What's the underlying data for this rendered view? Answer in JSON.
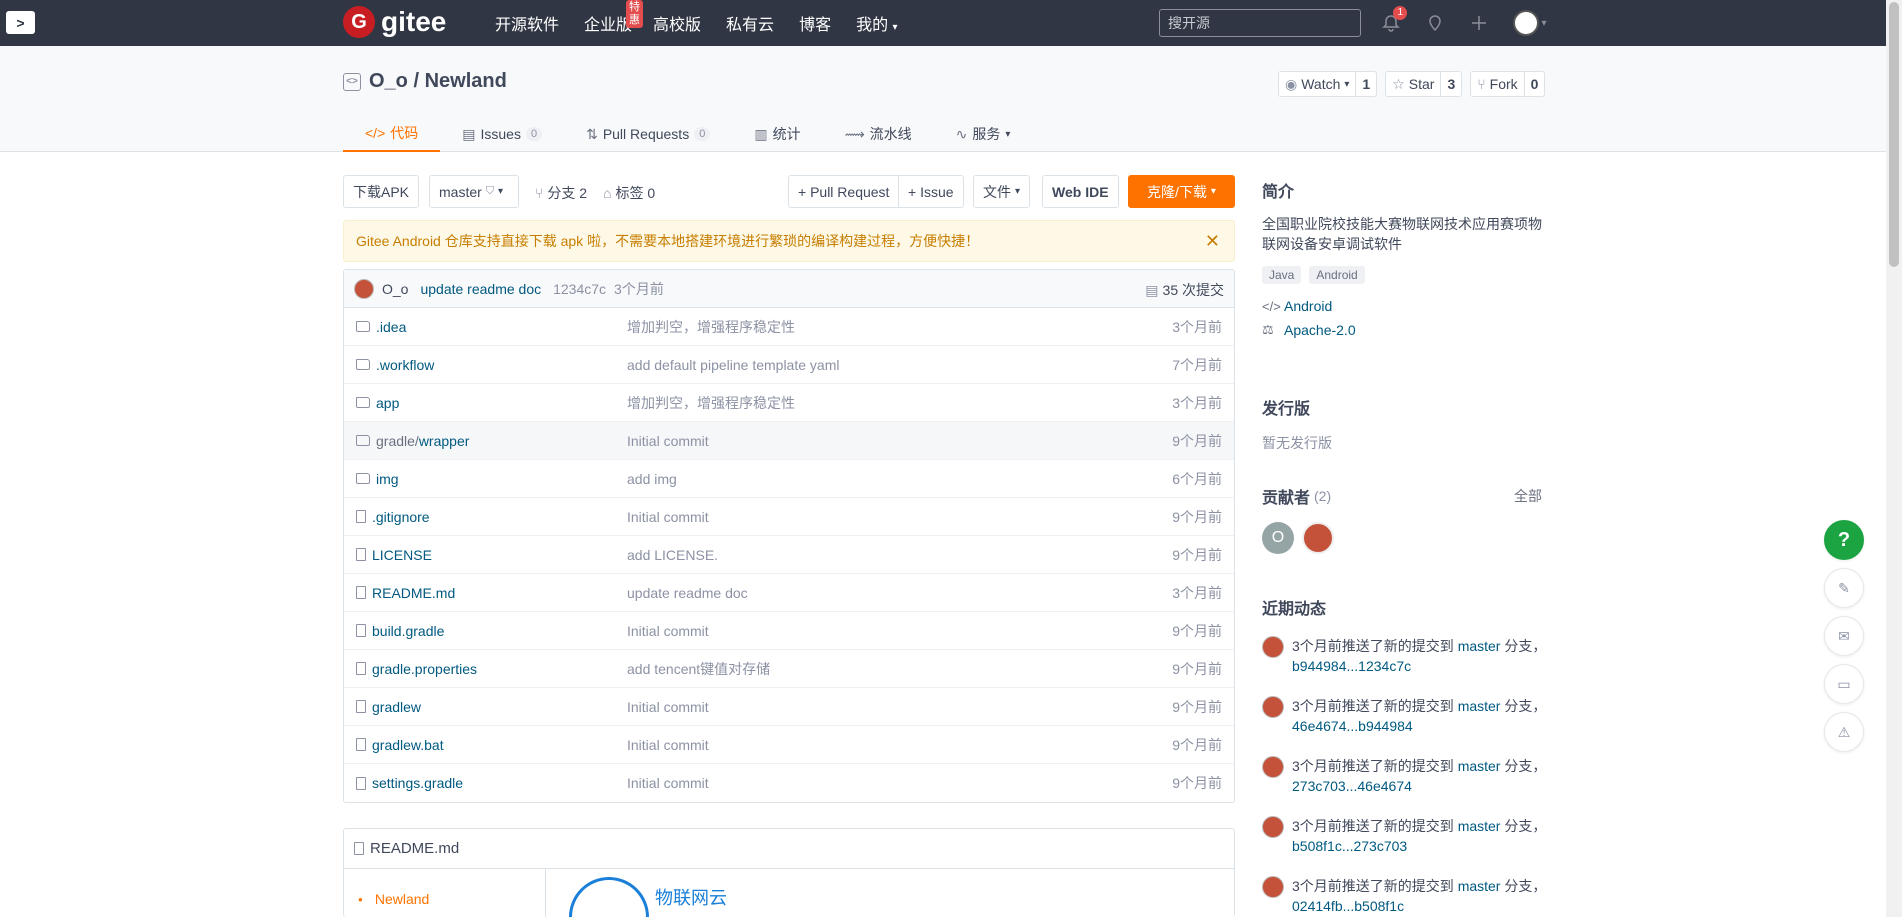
{
  "nav": {
    "logo_text": "gitee",
    "items": [
      "开源软件",
      "企业版",
      "高校版",
      "私有云",
      "博客",
      "我的"
    ],
    "badge": "特惠",
    "search_placeholder": "搜开源",
    "notif_count": "1"
  },
  "repo": {
    "owner_name": "O_o / Newland",
    "watch_label": "Watch",
    "watch_count": "1",
    "star_label": "Star",
    "star_count": "3",
    "fork_label": "Fork",
    "fork_count": "0",
    "tabs": [
      {
        "label": "代码"
      },
      {
        "label": "Issues",
        "count": "0"
      },
      {
        "label": "Pull Requests",
        "count": "0"
      },
      {
        "label": "统计"
      },
      {
        "label": "流水线"
      },
      {
        "label": "服务"
      }
    ]
  },
  "toolbar": {
    "download_apk": "下载APK",
    "branch": "master",
    "branches": "分支 2",
    "tags": "标签 0",
    "pull_request": "+ Pull Request",
    "issue": "+ Issue",
    "file": "文件",
    "web_ide": "Web IDE",
    "clone": "克隆/下载"
  },
  "notice": "Gitee Android 仓库支持直接下载 apk 啦，不需要本地搭建环境进行繁琐的编译构建过程，方便快捷！",
  "commit": {
    "author": "O_o",
    "message": "update readme doc",
    "hash": "1234c7c",
    "time": "3个月前",
    "count": "35 次提交"
  },
  "files": [
    {
      "type": "folder",
      "name": ".idea",
      "msg": "增加判空，增强程序稳定性",
      "time": "3个月前"
    },
    {
      "type": "folder",
      "name": ".workflow",
      "msg": "add default pipeline template yaml",
      "time": "7个月前"
    },
    {
      "type": "folder",
      "name": "app",
      "msg": "增加判空，增强程序稳定性",
      "time": "3个月前"
    },
    {
      "type": "folder",
      "name_prefix": "gradle/",
      "name": "wrapper",
      "msg": "Initial commit",
      "time": "9个月前"
    },
    {
      "type": "folder",
      "name": "img",
      "msg": "add img",
      "time": "6个月前"
    },
    {
      "type": "file",
      "name": ".gitignore",
      "msg": "Initial commit",
      "time": "9个月前"
    },
    {
      "type": "file",
      "name": "LICENSE",
      "msg": "add LICENSE.",
      "time": "9个月前"
    },
    {
      "type": "file",
      "name": "README.md",
      "msg": "update readme doc",
      "time": "3个月前"
    },
    {
      "type": "file",
      "name": "build.gradle",
      "msg": "Initial commit",
      "time": "9个月前"
    },
    {
      "type": "file",
      "name": "gradle.properties",
      "msg": "add tencent键值对存储",
      "time": "9个月前"
    },
    {
      "type": "file",
      "name": "gradlew",
      "msg": "Initial commit",
      "time": "9个月前"
    },
    {
      "type": "file",
      "name": "gradlew.bat",
      "msg": "Initial commit",
      "time": "9个月前"
    },
    {
      "type": "file",
      "name": "settings.gradle",
      "msg": "Initial commit",
      "time": "9个月前"
    }
  ],
  "readme": {
    "title": "README.md",
    "toc_item": "Newland",
    "logo_text": "物联网云"
  },
  "sidebar": {
    "intro_title": "简介",
    "intro_desc": "全国职业院校技能大赛物联网技术应用赛项物联网设备安卓调试软件",
    "tags": [
      "Java",
      "Android"
    ],
    "language": "Android",
    "license": "Apache-2.0",
    "release_title": "发行版",
    "release_empty": "暂无发行版",
    "contrib_title": "贡献者",
    "contrib_count": "(2)",
    "contrib_all": "全部",
    "contrib_letter": "O",
    "activity_title": "近期动态",
    "activity": [
      {
        "text": "3个月前推送了新的提交到",
        "branch": "master",
        "tail": " 分支，",
        "range": "b944984...1234c7c"
      },
      {
        "text": "3个月前推送了新的提交到",
        "branch": "master",
        "tail": " 分支，",
        "range": "46e4674...b944984"
      },
      {
        "text": "3个月前推送了新的提交到",
        "branch": "master",
        "tail": " 分支，",
        "range": "273c703...46e4674"
      },
      {
        "text": "3个月前推送了新的提交到",
        "branch": "master",
        "tail": " 分支，",
        "range": "b508f1c...273c703"
      },
      {
        "text": "3个月前推送了新的提交到",
        "branch": "master",
        "tail": " 分支，",
        "range": "02414fb...b508f1c"
      }
    ]
  },
  "float_help": "?",
  "colors": {
    "accent": "#fe7300",
    "link": "#005980",
    "topbar": "#303643",
    "help": "#1ca443"
  }
}
